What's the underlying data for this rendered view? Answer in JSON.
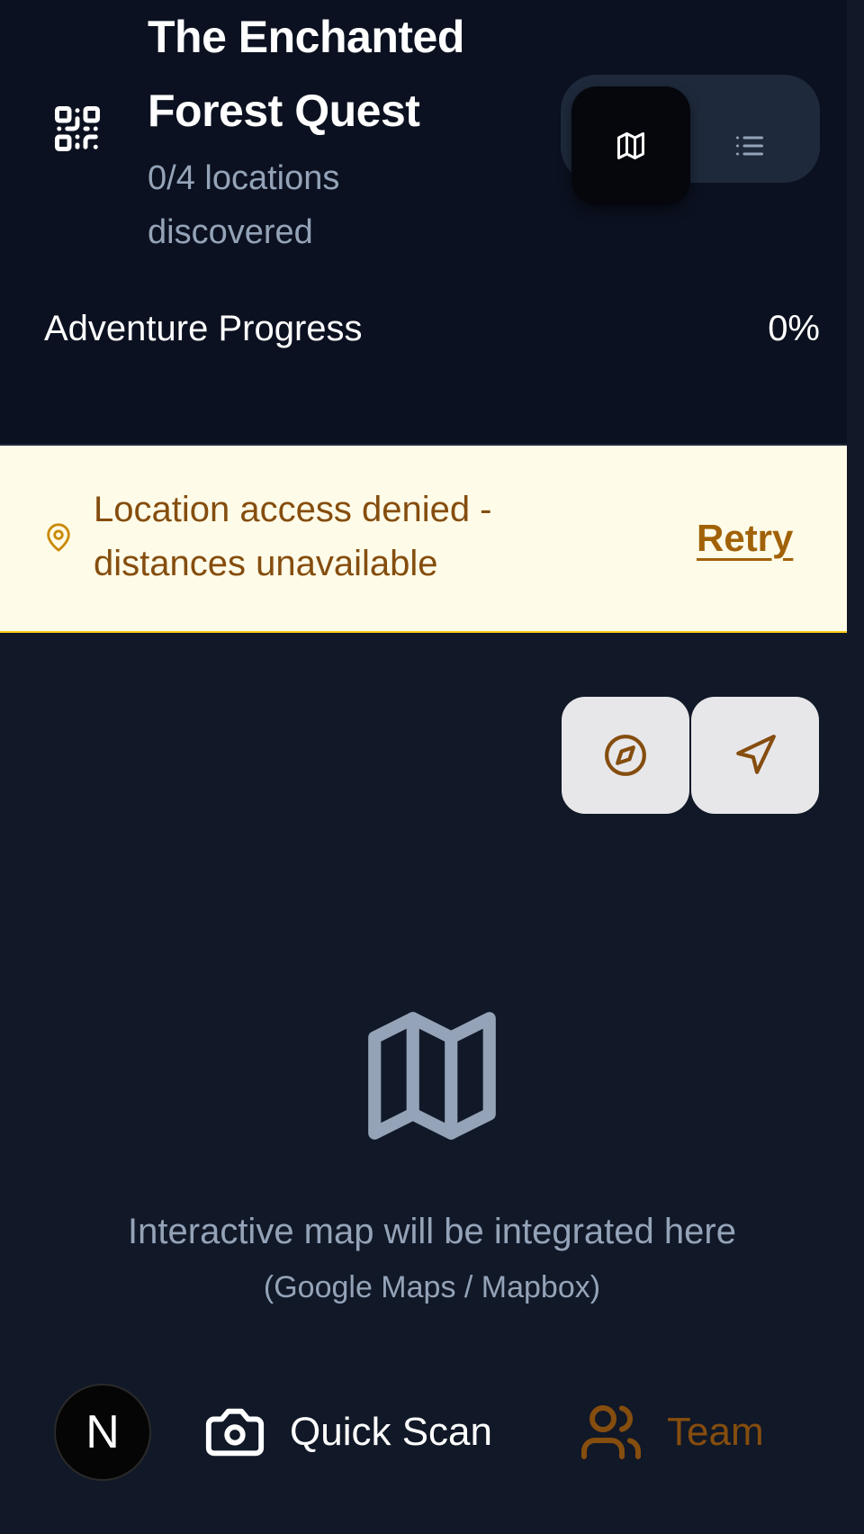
{
  "header": {
    "title": "The Enchanted Forest Quest",
    "subtitle": "0/4 locations discovered",
    "qr_icon": "qr-code-icon",
    "view_toggle": {
      "options": [
        {
          "name": "map",
          "icon": "map-icon",
          "active": true
        },
        {
          "name": "list",
          "icon": "list-icon",
          "active": false
        }
      ]
    }
  },
  "progress": {
    "label": "Adventure Progress",
    "value_text": "0%",
    "value": 0,
    "accent": "#f59e0b"
  },
  "banner": {
    "icon": "location-pin-icon",
    "message": "Location access denied - distances unavailable",
    "retry_label": "Retry",
    "colors": {
      "background": "#fefce8",
      "text": "#854d0e",
      "link": "#a16207"
    }
  },
  "map": {
    "controls": [
      {
        "name": "compass",
        "icon": "compass-icon"
      },
      {
        "name": "locate",
        "icon": "navigation-arrow-icon"
      }
    ],
    "placeholder_icon": "map-icon",
    "placeholder_text": "Interactive map will be integrated here",
    "placeholder_subtext": "(Google Maps / Mapbox)"
  },
  "bottom_nav": {
    "avatar_letter": "N",
    "scan_label": "Quick Scan",
    "scan_icon": "camera-icon",
    "team_label": "Team",
    "team_icon": "users-icon",
    "team_color": "#854d0e"
  },
  "colors": {
    "header_bg": "#0b1120",
    "page_bg": "#111827",
    "muted_text": "#94a3b8"
  }
}
